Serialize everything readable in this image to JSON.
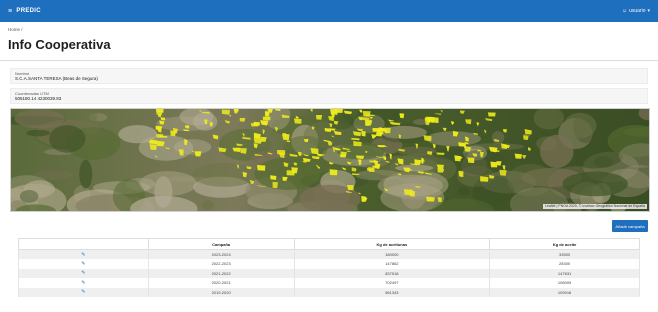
{
  "app": {
    "name": "PREDIC",
    "user": "usuario"
  },
  "breadcrumb": "Home /",
  "page": {
    "title": "Info Cooperativa"
  },
  "fields": {
    "nombre": {
      "label": "Nombre",
      "value": "S.C.A.SANTA TERESA (Beas de Segura)"
    },
    "coordenadas": {
      "label": "Coordenadas UTM",
      "value": "505180.14 4230039.83"
    }
  },
  "map": {
    "attribution": "Leaflet | PNOA 2020, © Instituto Geográfico Nacional de España",
    "colors": {
      "parcel": "#f0ec1a",
      "terrain_dark": "#3f5227",
      "terrain_light": "#9a9272"
    }
  },
  "actions": {
    "new_campaign": "Añadir campaña"
  },
  "table": {
    "headers": [
      "",
      "Campaña",
      "Kg de aceitunas",
      "Kg de aceite"
    ],
    "rows": [
      {
        "campaign": "2023-2024",
        "kg_olives": "180000",
        "kg_oil": "33500"
      },
      {
        "campaign": "2022-2023",
        "kg_olives": "147862",
        "kg_oil": "28300"
      },
      {
        "campaign": "2021-2022",
        "kg_olives": "837518",
        "kg_oil": "147631"
      },
      {
        "campaign": "2020-2021",
        "kg_olives": "702497",
        "kg_oil": "108009"
      },
      {
        "campaign": "2019-2020",
        "kg_olives": "561343",
        "kg_oil": "109016"
      }
    ]
  }
}
